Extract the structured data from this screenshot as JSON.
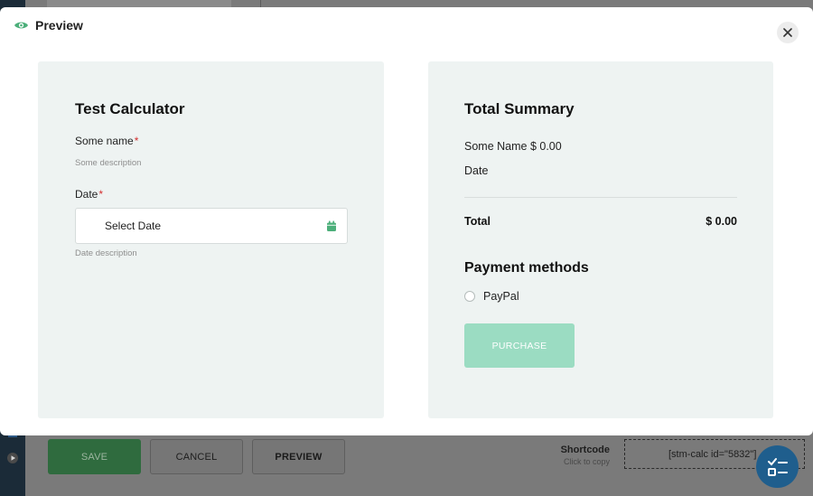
{
  "modal": {
    "title": "Preview",
    "icons": {
      "title": "eye-icon",
      "close": "close-icon"
    }
  },
  "calculator": {
    "title": "Test Calculator",
    "fields": [
      {
        "label": "Some name",
        "required_mark": "*",
        "description": "Some description"
      },
      {
        "label": "Date",
        "required_mark": "*",
        "description": "Date description",
        "placeholder": "Select Date",
        "icon": "calendar-icon"
      }
    ]
  },
  "summary": {
    "title": "Total Summary",
    "lines": [
      "Some Name $ 0.00",
      "Date"
    ],
    "total_label": "Total",
    "total_value": "$ 0.00",
    "payment_title": "Payment methods",
    "payment_options": [
      "PayPal"
    ],
    "purchase_label": "PURCHASE"
  },
  "background": {
    "buttons": {
      "save": "SAVE",
      "cancel": "CANCEL",
      "preview": "PREVIEW"
    },
    "shortcode_label": "Shortcode",
    "shortcode_hint": "Click to copy",
    "shortcode_value": "[stm-calc id=\"5832\"]"
  },
  "colors": {
    "accent_green": "#4caf7a",
    "purchase_disabled": "#9bdcc2",
    "panel_bg": "#eef3f2",
    "required": "#d32f2f"
  }
}
